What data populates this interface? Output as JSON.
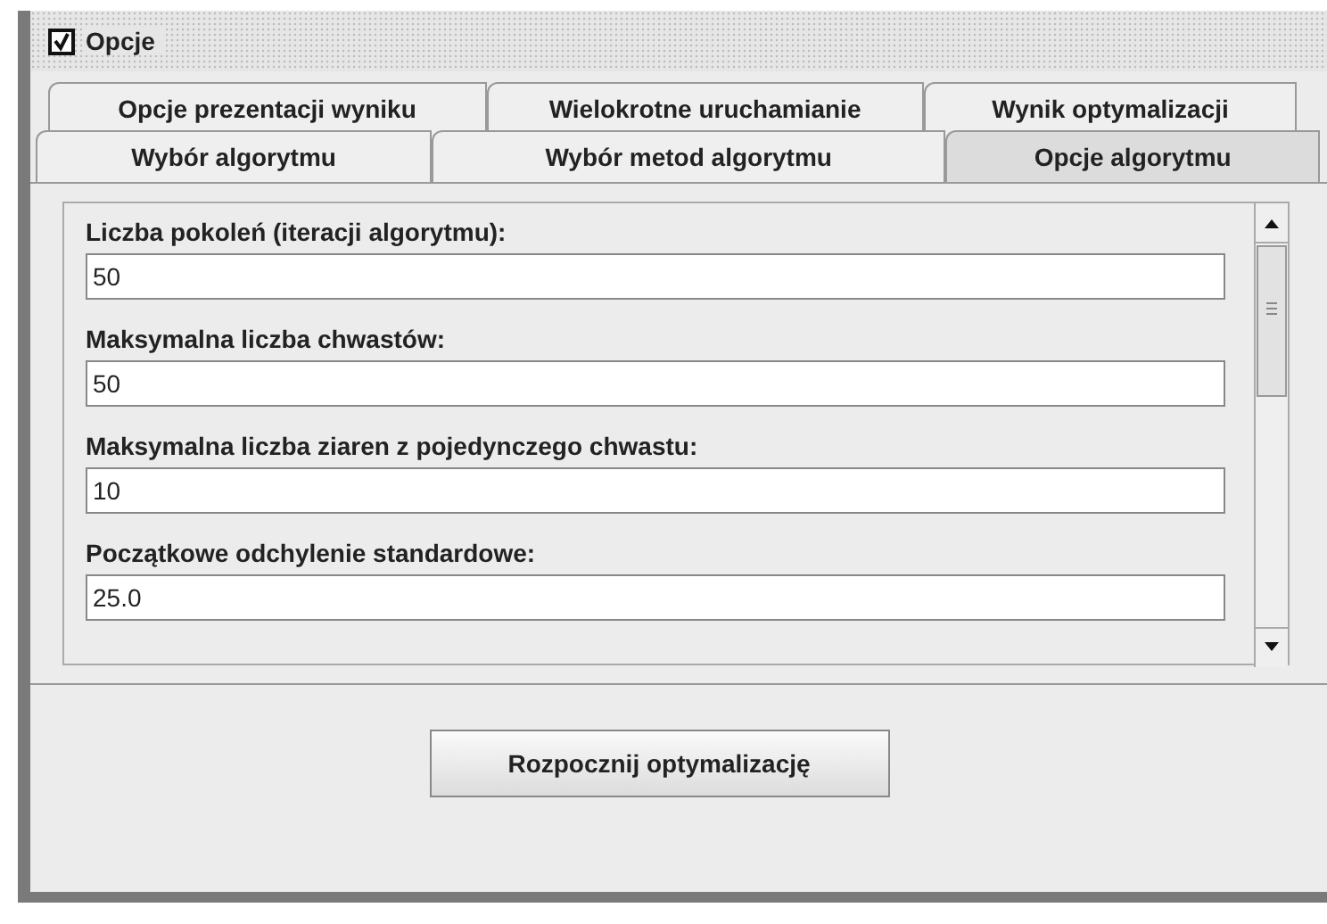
{
  "window": {
    "title": "Opcje",
    "checked": true
  },
  "tab_rows": [
    {
      "tabs": [
        {
          "label": "Opcje prezentacji wyniku",
          "selected": false
        },
        {
          "label": "Wielokrotne uruchamianie",
          "selected": false
        },
        {
          "label": "Wynik optymalizacji",
          "selected": false
        }
      ]
    },
    {
      "tabs": [
        {
          "label": "Wybór algorytmu",
          "selected": false
        },
        {
          "label": "Wybór metod algorytmu",
          "selected": false
        },
        {
          "label": "Opcje algorytmu",
          "selected": true
        }
      ]
    }
  ],
  "fields": [
    {
      "label": "Liczba pokoleń (iteracji algorytmu):",
      "value": "50"
    },
    {
      "label": "Maksymalna liczba chwastów:",
      "value": "50"
    },
    {
      "label": "Maksymalna liczba ziaren z pojedynczego chwastu:",
      "value": "10"
    },
    {
      "label": "Początkowe odchylenie standardowe:",
      "value": "25.0"
    }
  ],
  "button": {
    "label": "Rozpocznij optymalizację"
  }
}
